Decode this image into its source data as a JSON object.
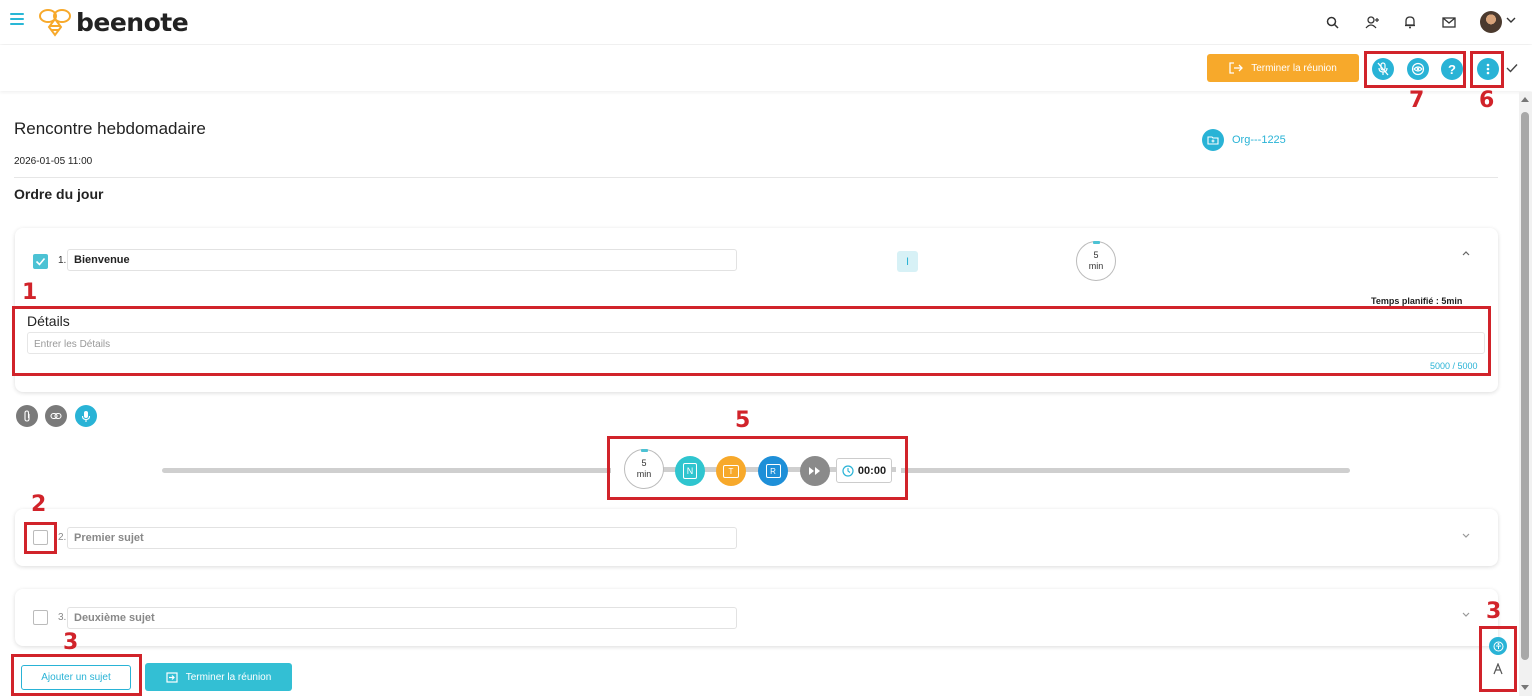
{
  "header": {
    "logo_text": "beenote",
    "icons": [
      "menu-icon",
      "search-icon",
      "add-user-icon",
      "bell-icon",
      "mail-icon",
      "avatar"
    ]
  },
  "toolbar": {
    "end_meeting_label": "Terminer la réunion",
    "icons": [
      "mic-off-icon",
      "eye-icon",
      "help-icon",
      "more-vertical-icon",
      "check-icon"
    ]
  },
  "meeting": {
    "title": "Rencontre hebdomadaire",
    "datetime": "2026-01-05 11:00",
    "org": "Org---1225",
    "agenda_heading": "Ordre du jour"
  },
  "topics": [
    {
      "number": "1.",
      "title": "Bienvenue",
      "checked": true,
      "badge": "I",
      "timer_value": "5",
      "timer_unit": "min",
      "planned_time": "Temps planifié : 5min",
      "details_label": "Détails",
      "details_placeholder": "Entrer les Détails",
      "char_count": "5000 / 5000"
    },
    {
      "number": "2.",
      "title": "Premier sujet",
      "checked": false
    },
    {
      "number": "3.",
      "title": "Deuxième sujet",
      "checked": false
    }
  ],
  "controls": {
    "timer_value": "5",
    "timer_unit": "min",
    "note_letter": "N",
    "task_letter": "T",
    "decision_letter": "R",
    "clock": "00:00"
  },
  "footer": {
    "add_topic_label": "Ajouter un sujet",
    "end_meeting_label": "Terminer la réunion"
  },
  "annotations": {
    "n1": "1",
    "n2": "2",
    "n3a": "3",
    "n3b": "3",
    "n5": "5",
    "n6": "6",
    "n7": "7"
  },
  "colors": {
    "accent": "#29b3d6",
    "orange": "#f7a92b",
    "annotation_red": "#d1232a"
  }
}
